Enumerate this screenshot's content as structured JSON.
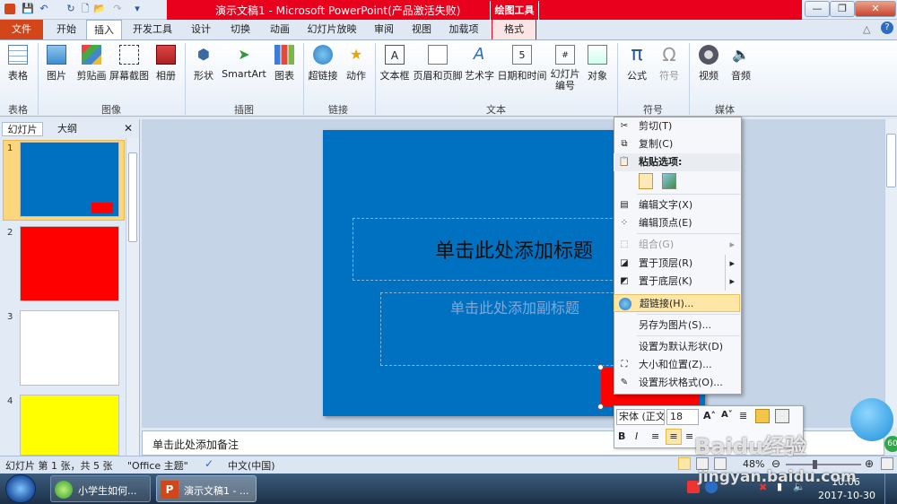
{
  "window": {
    "title": "演示文稿1 - Microsoft PowerPoint(产品激活失败)",
    "contextual_tab_group": "绘图工具",
    "controls": {
      "minimize": "—",
      "restore": "❐",
      "close": "✕"
    }
  },
  "tabs": [
    "文件",
    "开始",
    "插入",
    "开发工具",
    "设计",
    "切换",
    "动画",
    "幻灯片放映",
    "审阅",
    "视图",
    "加载项",
    "格式"
  ],
  "active_tab": "插入",
  "ribbon": {
    "groups": [
      {
        "label": "表格",
        "buttons": [
          {
            "label": "表格",
            "icon": "table-icon"
          }
        ]
      },
      {
        "label": "图像",
        "buttons": [
          {
            "label": "图片",
            "icon": "picture-icon"
          },
          {
            "label": "剪贴画",
            "icon": "clipart-icon"
          },
          {
            "label": "屏幕截图",
            "icon": "screenshot-icon"
          },
          {
            "label": "相册",
            "icon": "album-icon"
          }
        ]
      },
      {
        "label": "插图",
        "buttons": [
          {
            "label": "形状",
            "icon": "shapes-icon"
          },
          {
            "label": "SmartArt",
            "icon": "smartart-icon"
          },
          {
            "label": "图表",
            "icon": "chart-icon"
          }
        ]
      },
      {
        "label": "链接",
        "buttons": [
          {
            "label": "超链接",
            "icon": "hyperlink-icon"
          },
          {
            "label": "动作",
            "icon": "action-icon"
          }
        ]
      },
      {
        "label": "文本",
        "buttons": [
          {
            "label": "文本框",
            "icon": "textbox-icon"
          },
          {
            "label": "页眉和页脚",
            "icon": "header-footer-icon"
          },
          {
            "label": "艺术字",
            "icon": "wordart-icon"
          },
          {
            "label": "日期和时间",
            "icon": "datetime-icon"
          },
          {
            "label": "幻灯片编号",
            "icon": "slide-number-icon"
          },
          {
            "label": "对象",
            "icon": "object-icon"
          }
        ]
      },
      {
        "label": "符号",
        "buttons": [
          {
            "label": "公式",
            "icon": "equation-icon"
          },
          {
            "label": "符号",
            "icon": "symbol-icon"
          }
        ]
      },
      {
        "label": "媒体",
        "buttons": [
          {
            "label": "视频",
            "icon": "video-icon"
          },
          {
            "label": "音频",
            "icon": "audio-icon"
          }
        ]
      }
    ]
  },
  "slide_panel": {
    "tabs": [
      "幻灯片",
      "大纲"
    ],
    "close": "✕",
    "slides": [
      {
        "number": "1",
        "color": "#0070c0"
      },
      {
        "number": "2",
        "color": "#ff0000"
      },
      {
        "number": "3",
        "color": "#ffffff"
      },
      {
        "number": "4",
        "color": "#ffff00"
      }
    ]
  },
  "slide": {
    "title_placeholder": "单击此处添加标题",
    "subtitle_placeholder": "单击此处添加副标题",
    "background": "#0070c0",
    "shape_color": "#ff0000"
  },
  "notes_placeholder": "单击此处添加备注",
  "context_menu": {
    "items": [
      {
        "label": "剪切(T)",
        "icon": "scissors-icon"
      },
      {
        "label": "复制(C)",
        "icon": "copy-icon"
      },
      {
        "label": "粘贴选项:",
        "icon": "paste-icon"
      },
      {
        "label": "编辑文字(X)",
        "icon": "edit-text-icon"
      },
      {
        "label": "编辑顶点(E)",
        "icon": "edit-points-icon"
      },
      {
        "label": "组合(G)",
        "icon": "group-icon"
      },
      {
        "label": "置于顶层(R)",
        "icon": "bring-front-icon"
      },
      {
        "label": "置于底层(K)",
        "icon": "send-back-icon"
      },
      {
        "label": "超链接(H)...",
        "icon": "hyperlink-icon"
      },
      {
        "label": "另存为图片(S)...",
        "icon": ""
      },
      {
        "label": "设置为默认形状(D)",
        "icon": ""
      },
      {
        "label": "大小和位置(Z)...",
        "icon": "size-icon"
      },
      {
        "label": "设置形状格式(O)...",
        "icon": "format-shape-icon"
      }
    ],
    "highlighted": "超链接(H)..."
  },
  "mini_toolbar": {
    "font": "宋体 (正文",
    "size": "18",
    "bold": "B",
    "italic": "I"
  },
  "status": {
    "slide_info": "幻灯片 第 1 张，共 5 张",
    "theme": "\"Office 主题\"",
    "language": "中文(中国)",
    "zoom": "48%"
  },
  "taskbar": {
    "items": [
      "小学生如何...",
      "演示文稿1 - ..."
    ],
    "time": "10:06",
    "date": "2017-10-30",
    "watermark": "Baidu经验",
    "watermark_url": "jingyan.baidu.com",
    "badge": "60"
  }
}
